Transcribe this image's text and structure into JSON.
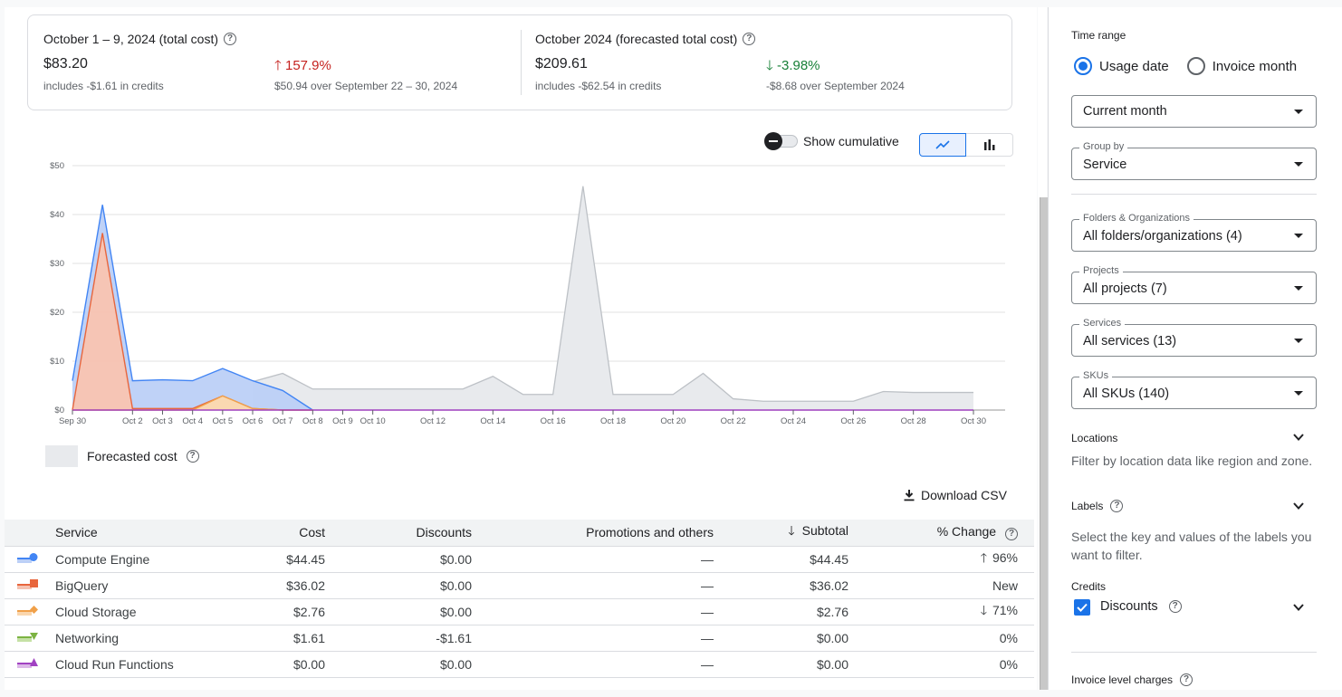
{
  "summary": {
    "current": {
      "title": "October 1 – 9, 2024 (total cost)",
      "value": "$83.20",
      "credits_note": "includes -$1.61 in credits",
      "change": "157.9%",
      "change_direction": "up",
      "change_note": "$50.94 over September 22 – 30, 2024"
    },
    "forecast": {
      "title": "October 2024 (forecasted total cost)",
      "value": "$209.61",
      "credits_note": "includes -$62.54 in credits",
      "change": "-3.98%",
      "change_direction": "down",
      "change_note": "-$8.68 over September 2024"
    }
  },
  "controls": {
    "show_cumulative_label": "Show cumulative",
    "show_cumulative_on": false,
    "chart_type_options": [
      "line-chart-icon",
      "bar-chart-icon"
    ],
    "chart_type_selected": "line-chart-icon"
  },
  "chart_data": {
    "type": "area",
    "title": "",
    "xlabel": "",
    "ylabel": "",
    "ylim": [
      0,
      50
    ],
    "y_ticks": [
      "$0",
      "$10",
      "$20",
      "$30",
      "$40",
      "$50"
    ],
    "y_tick_values": [
      0,
      10,
      20,
      30,
      40,
      50
    ],
    "x": [
      "Sep 30",
      "Oct 1",
      "Oct 2",
      "Oct 3",
      "Oct 4",
      "Oct 5",
      "Oct 6",
      "Oct 7",
      "Oct 8",
      "Oct 9",
      "Oct 10",
      "Oct 11",
      "Oct 12",
      "Oct 13",
      "Oct 14",
      "Oct 15",
      "Oct 16",
      "Oct 17",
      "Oct 18",
      "Oct 19",
      "Oct 20",
      "Oct 21",
      "Oct 22",
      "Oct 23",
      "Oct 24",
      "Oct 25",
      "Oct 26",
      "Oct 27",
      "Oct 28",
      "Oct 29",
      "Oct 30"
    ],
    "x_tick_labels": [
      {
        "index": 0,
        "label": "Sep 30"
      },
      {
        "index": 2,
        "label": "Oct 2"
      },
      {
        "index": 3,
        "label": "Oct 3"
      },
      {
        "index": 4,
        "label": "Oct 4"
      },
      {
        "index": 5,
        "label": "Oct 5"
      },
      {
        "index": 6,
        "label": "Oct 6"
      },
      {
        "index": 7,
        "label": "Oct 7"
      },
      {
        "index": 8,
        "label": "Oct 8"
      },
      {
        "index": 9,
        "label": "Oct 9"
      },
      {
        "index": 10,
        "label": "Oct 10"
      },
      {
        "index": 12,
        "label": "Oct 12"
      },
      {
        "index": 14,
        "label": "Oct 14"
      },
      {
        "index": 16,
        "label": "Oct 16"
      },
      {
        "index": 18,
        "label": "Oct 18"
      },
      {
        "index": 20,
        "label": "Oct 20"
      },
      {
        "index": 22,
        "label": "Oct 22"
      },
      {
        "index": 24,
        "label": "Oct 24"
      },
      {
        "index": 26,
        "label": "Oct 26"
      },
      {
        "index": 28,
        "label": "Oct 28"
      },
      {
        "index": 30,
        "label": "Oct 30"
      }
    ],
    "stacked": true,
    "series": [
      {
        "name": "Forecasted cost",
        "color": "#bdc1c6",
        "fill": "#e8eaed",
        "start_index": 6,
        "values": [
          5.8,
          7.5,
          4.3,
          4.3,
          4.3,
          4.3,
          4.3,
          4.3,
          6.9,
          3.2,
          3.2,
          45.8,
          3.2,
          3.2,
          3.2,
          7.5,
          2.3,
          1.8,
          1.8,
          1.8,
          1.8,
          3.8,
          3.6,
          3.6,
          3.6
        ]
      },
      {
        "name": "Compute Engine",
        "color": "#4285f4",
        "fill": "#bcd0f7",
        "start_index": 0,
        "values": [
          6.0,
          5.8,
          5.7,
          5.9,
          5.7,
          5.6,
          5.7,
          4.0,
          0.0
        ]
      },
      {
        "name": "BigQuery",
        "color": "#e8663d",
        "fill": "#f5c2b1",
        "start_index": 0,
        "values": [
          0.0,
          36.2,
          0.3,
          0.3,
          0.3,
          0.0,
          0.0,
          0.0,
          0.0
        ]
      },
      {
        "name": "Cloud Storage",
        "color": "#f0a049",
        "fill": "#fad6ad",
        "start_index": 0,
        "values": [
          0.0,
          0.0,
          0.0,
          0.0,
          0.0,
          2.9,
          0.3,
          0.0,
          0.0
        ]
      },
      {
        "name": "Networking",
        "color": "#7cb342",
        "fill": "#c5e1a5",
        "start_index": 0,
        "values": [
          0.0,
          0.0,
          0.0,
          0.0,
          0.0,
          0.0,
          0.0,
          0.0,
          0.0
        ]
      },
      {
        "name": "Cloud Run Functions",
        "color": "#a142c2",
        "fill": "#dcb8e8",
        "start_index": 0,
        "values": [
          0.0,
          0.0,
          0.0,
          0.0,
          0.0,
          0.0,
          0.0,
          0.0,
          0.0,
          0.0,
          0.0,
          0.0,
          0.0,
          0.0,
          0.0,
          0.0,
          0.0,
          0.0,
          0.0,
          0.0,
          0.0,
          0.0,
          0.0,
          0.0,
          0.0,
          0.0,
          0.0,
          0.0,
          0.0,
          0.0,
          0.0
        ]
      }
    ],
    "legend": [
      {
        "name": "Forecasted cost",
        "placement": "bottom-left"
      }
    ],
    "grid": true
  },
  "download_csv_label": "Download CSV",
  "table": {
    "columns": [
      "Service",
      "Cost",
      "Discounts",
      "Promotions and others",
      "Subtotal",
      "% Change"
    ],
    "sort_column": "Subtotal",
    "sort_direction": "desc",
    "rows": [
      {
        "service": "Compute Engine",
        "icon": "circle-marker-icon",
        "color": "#4285f4",
        "cost": "$44.45",
        "discounts": "$0.00",
        "promotions": "—",
        "subtotal": "$44.45",
        "change": "96%",
        "change_direction": "up"
      },
      {
        "service": "BigQuery",
        "icon": "square-marker-icon",
        "color": "#e8663d",
        "cost": "$36.02",
        "discounts": "$0.00",
        "promotions": "—",
        "subtotal": "$36.02",
        "change": "New",
        "change_direction": "none"
      },
      {
        "service": "Cloud Storage",
        "icon": "diamond-marker-icon",
        "color": "#f0a049",
        "cost": "$2.76",
        "discounts": "$0.00",
        "promotions": "—",
        "subtotal": "$2.76",
        "change": "71%",
        "change_direction": "down"
      },
      {
        "service": "Networking",
        "icon": "triangle-down-marker-icon",
        "color": "#7cb342",
        "cost": "$1.61",
        "discounts": "-$1.61",
        "promotions": "—",
        "subtotal": "$0.00",
        "change": "0%",
        "change_direction": "none"
      },
      {
        "service": "Cloud Run Functions",
        "icon": "triangle-up-marker-icon",
        "color": "#a142c2",
        "cost": "$0.00",
        "discounts": "$0.00",
        "promotions": "—",
        "subtotal": "$0.00",
        "change": "0%",
        "change_direction": "none"
      }
    ]
  },
  "filters": {
    "time_range_label": "Time range",
    "time_range_options": [
      "Usage date",
      "Invoice month"
    ],
    "time_range_selected": "Usage date",
    "period_value": "Current month",
    "group_by_label": "Group by",
    "group_by_value": "Service",
    "folders_label": "Folders & Organizations",
    "folders_value": "All folders/organizations (4)",
    "projects_label": "Projects",
    "projects_value": "All projects (7)",
    "services_label": "Services",
    "services_value": "All services (13)",
    "skus_label": "SKUs",
    "skus_value": "All SKUs (140)",
    "locations_label": "Locations",
    "locations_desc": "Filter by location data like region and zone.",
    "labels_label": "Labels",
    "labels_desc": "Select the key and values of the labels you want to filter.",
    "credits_label": "Credits",
    "discounts_label": "Discounts",
    "discounts_checked": true,
    "invoice_charges_label": "Invoice level charges"
  }
}
